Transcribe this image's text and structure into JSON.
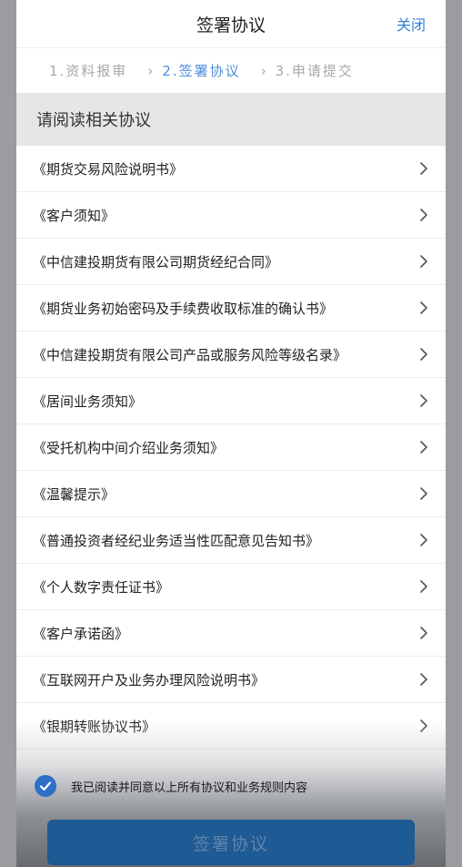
{
  "header": {
    "title": "签署协议",
    "close_label": "关闭"
  },
  "steps": [
    {
      "label": "1.资料报审",
      "active": false
    },
    {
      "label": "2.签署协议",
      "active": true
    },
    {
      "label": "3.申请提交",
      "active": false
    }
  ],
  "step_separator": "›",
  "section_title": "请阅读相关协议",
  "agreements": [
    "《期货交易风险说明书》",
    "《客户须知》",
    "《中信建投期货有限公司期货经纪合同》",
    "《期货业务初始密码及手续费收取标准的确认书》",
    "《中信建投期货有限公司产品或服务风险等级名录》",
    "《居间业务须知》",
    "《受托机构中间介绍业务须知》",
    "《温馨提示》",
    "《普通投资者经纪业务适当性匹配意见告知书》",
    "《个人数字责任证书》",
    "《客户承诺函》",
    "《互联网开户及业务办理风险说明书》",
    "《银期转账协议书》"
  ],
  "agree": {
    "checked": true,
    "text": "我已阅读并同意以上所有协议和业务规则内容"
  },
  "sign_button_label": "签署协议",
  "colors": {
    "accent": "#2f7fd6",
    "button": "#1e5a93"
  }
}
